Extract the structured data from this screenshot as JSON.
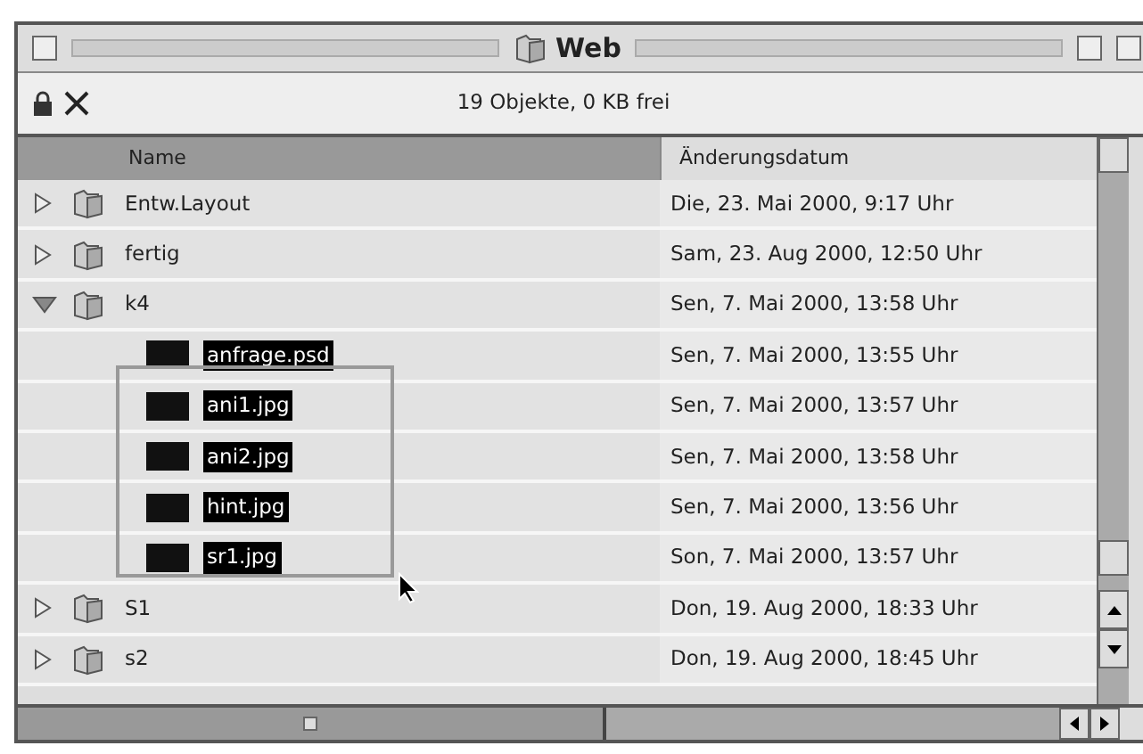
{
  "window": {
    "title": "Web"
  },
  "info_bar": {
    "text": "19 Objekte, 0 KB frei"
  },
  "columns": [
    {
      "label": "Name",
      "selected": true
    },
    {
      "label": "Änderungsdatum",
      "selected": false
    }
  ],
  "rows": [
    {
      "kind": "folder",
      "name": "Entw.Layout",
      "date": "Die, 23. Mai 2000, 9:17 Uhr",
      "expanded": false,
      "selected": false
    },
    {
      "kind": "folder",
      "name": "fertig",
      "date": "Sam, 23. Aug 2000, 12:50 Uhr",
      "expanded": false,
      "selected": false
    },
    {
      "kind": "folder",
      "name": "k4",
      "date": "Sen, 7. Mai 2000, 13:58 Uhr",
      "expanded": true,
      "selected": false,
      "children": [
        {
          "kind": "file",
          "name": "anfrage.psd",
          "date": "Sen, 7. Mai 2000, 13:55 Uhr",
          "selected": true
        },
        {
          "kind": "file",
          "name": "ani1.jpg",
          "date": "Sen, 7. Mai 2000, 13:57 Uhr",
          "selected": true
        },
        {
          "kind": "file",
          "name": "ani2.jpg",
          "date": "Sen, 7. Mai 2000, 13:58 Uhr",
          "selected": true
        },
        {
          "kind": "file",
          "name": "hint.jpg",
          "date": "Sen, 7. Mai 2000, 13:56 Uhr",
          "selected": true
        },
        {
          "kind": "file",
          "name": "sr1.jpg",
          "date": "Son, 7. Mai 2000, 13:57 Uhr",
          "selected": true
        }
      ]
    },
    {
      "kind": "folder",
      "name": "S1",
      "date": "Don, 19. Aug 2000, 18:33 Uhr",
      "expanded": false,
      "selected": false
    },
    {
      "kind": "folder",
      "name": "s2",
      "date": "Don, 19. Aug 2000, 18:45 Uhr",
      "expanded": false,
      "selected": false
    }
  ]
}
